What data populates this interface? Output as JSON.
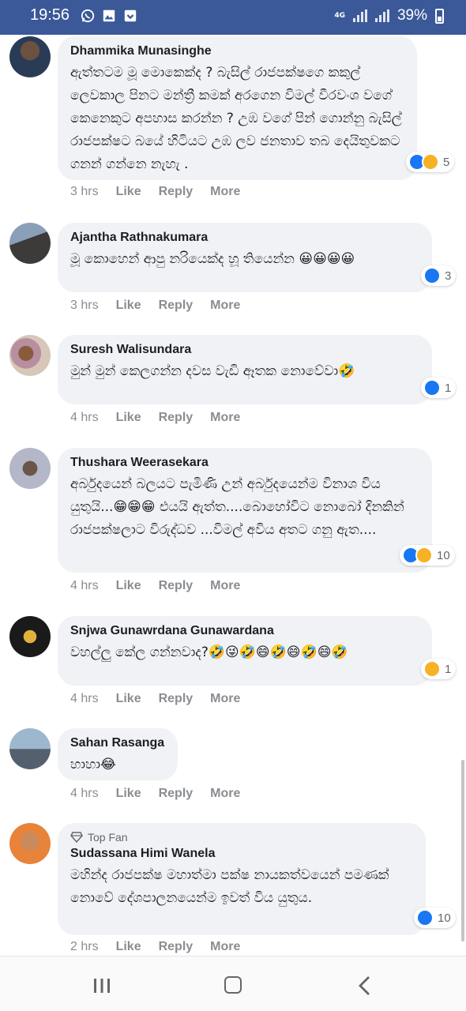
{
  "status_bar": {
    "time": "19:56",
    "network": "4G",
    "battery": "39%",
    "icons": [
      "whatsapp-icon",
      "gallery-icon",
      "download-icon",
      "signal-icon",
      "battery-icon"
    ]
  },
  "comments": [
    {
      "author": "Dhammika Munasinghe",
      "text": "ඇත්තටම මූ මොකෙක්ද ? බැසිල් රාජපක්ෂගෙ කකුල් ලෙවකාල පිනට මන්ත්‍රී කමක් අරගෙන විමල් වීරවංශ වගේ කෙනෙකුට අපහාස කරන්න ? උඹ වගේ පින් ගොන්නු බැසිල් රාජපක්ෂට බයේ හිටියට උඹ ලව ජනතාව තබ දෙයිතුවකට ගනන් ගන්නෙ නැහැ .",
      "time": "3 hrs",
      "like": "Like",
      "reply": "Reply",
      "more": "More",
      "reaction_count": "5",
      "reactions": [
        "like",
        "haha"
      ]
    },
    {
      "author": "Ajantha Rathnakumara",
      "text": "මූ කොහෙන් ආපු නරියෙක්ද හූ තියෙන්න 😀😀😀😀",
      "time": "3 hrs",
      "like": "Like",
      "reply": "Reply",
      "more": "More",
      "reaction_count": "3",
      "reactions": [
        "like"
      ]
    },
    {
      "author": "Suresh Walisundara",
      "text": "මුන් මුන් කෙලගන්න දවස වැඩි ඈතක නොවේවා🤣",
      "time": "4 hrs",
      "like": "Like",
      "reply": "Reply",
      "more": "More",
      "reaction_count": "1",
      "reactions": [
        "like"
      ]
    },
    {
      "author": "Thushara Weerasekara",
      "text": "අර්බුදයෙන් බලයට පැමිණි උන් අර්බුදයෙන්ම විනාශ විය යුතුයි...😁😁😁 එයයි ඇත්ත....බොහෝවිට නොබෝ දිනකින් රාජපක්ෂලාට විරුද්ධව ...විමල් අවිය අතට ගනු ඇත....",
      "time": "4 hrs",
      "like": "Like",
      "reply": "Reply",
      "more": "More",
      "reaction_count": "10",
      "reactions": [
        "like",
        "haha"
      ]
    },
    {
      "author": "Snjwa Gunawrdana Gunawardana",
      "text": "වහල්ලු කේල ගන්නවාද?🤣😜🤣😄🤣😄🤣😄🤣",
      "time": "4 hrs",
      "like": "Like",
      "reply": "Reply",
      "more": "More",
      "reaction_count": "1",
      "reactions": [
        "haha"
      ]
    },
    {
      "author": "Sahan Rasanga",
      "text": "හාහා😂",
      "time": "4 hrs",
      "like": "Like",
      "reply": "Reply",
      "more": "More",
      "reaction_count": "",
      "reactions": []
    },
    {
      "badge": "Top Fan",
      "author": "Sudassana Himi Wanela",
      "text": "මහින්ද රාජපක්ෂ මහාත්මා පක්ෂ නායකත්වයෙන් පමණක් නොවේ දේශපාලනයෙන්ම ඉවත් විය යුතුය.",
      "time": "2 hrs",
      "like": "Like",
      "reply": "Reply",
      "more": "More",
      "reaction_count": "10",
      "reactions": [
        "like"
      ]
    }
  ],
  "nav_bar": {
    "buttons": [
      "recent-apps-button",
      "home-button",
      "back-button"
    ]
  }
}
